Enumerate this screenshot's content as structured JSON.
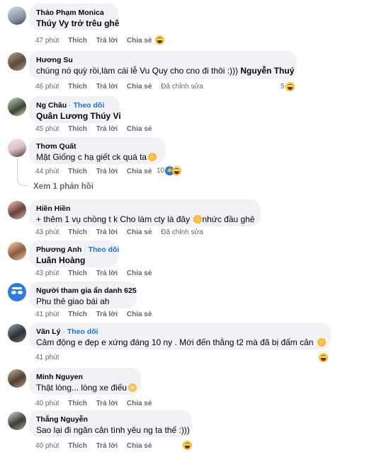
{
  "comments": [
    {
      "name": "Thảo Phạm Monica",
      "follow": "",
      "text": "Thúy Vy trở trêu ghê",
      "time": "47 phút",
      "like": "Thích",
      "reply": "Trả lời",
      "share": "Chia sẻ",
      "edited": "",
      "count": ""
    },
    {
      "name": "Hương Su",
      "follow": "",
      "text": "chúng nó quỳ rồi,làm cái lễ Vu Quy cho cno đi thôi :)))",
      "tag": "Nguyễn Thuý",
      "time": "46 phút",
      "like": "Thích",
      "reply": "Trả lời",
      "share": "Chia sẻ",
      "edited": "Đã chỉnh sửa",
      "count": "5"
    },
    {
      "name": "Ng Châu",
      "follow": "Theo dõi",
      "text": "Quân Lương Thúy Vi",
      "time": "45 phút",
      "like": "Thích",
      "reply": "Trả lời",
      "share": "Chia sẻ",
      "edited": "",
      "count": ""
    },
    {
      "name": "Thơm Quất",
      "follow": "",
      "text": "Mặt Giống c hạ giết ck quá ta",
      "time": "44 phút",
      "like": "Thích",
      "reply": "Trả lời",
      "share": "Chia sẻ",
      "edited": "",
      "count": "10"
    },
    {
      "name": "Hiền Hiền",
      "follow": "",
      "text": "+ thêm 1 vụ chồng t k Cho làm cty là đây",
      "text2": "nhức đầu ghê",
      "time": "43 phút",
      "like": "Thích",
      "reply": "Trả lời",
      "share": "Chia sẻ",
      "edited": "Đã chỉnh sửa",
      "count": ""
    },
    {
      "name": "Phương Anh",
      "follow": "Theo dõi",
      "text": "Luân Hoàng",
      "time": "43 phút",
      "like": "Thích",
      "reply": "Trả lời",
      "share": "Chia sẻ",
      "edited": "",
      "count": ""
    },
    {
      "name": "Người tham gia ẩn danh 625",
      "follow": "",
      "text": "Phu thê giao bái ah",
      "time": "41 phút",
      "like": "Thích",
      "reply": "Trả lời",
      "share": "Chia sẻ",
      "edited": "",
      "count": ""
    },
    {
      "name": "Văn Lý",
      "follow": "Theo dõi",
      "text": "Cảm động e đẹp e xứng đáng 10 ny . Mới đến thằng t2 mà đã bị đấm cản",
      "time": "41 phút",
      "like": "Thích",
      "reply": "Trả lời",
      "share": "Chia sẻ",
      "edited": "",
      "count": ""
    },
    {
      "name": "Minh Nguyen",
      "follow": "",
      "text": "Thật lòng... lòng xe điếu",
      "time": "40 phút",
      "like": "Thích",
      "reply": "Trả lời",
      "share": "Chia sẻ",
      "edited": "",
      "count": ""
    },
    {
      "name": "Thắng Nguyễn",
      "follow": "",
      "text": "Sao lại đi ngăn cản tình yêu ng ta thế :)))",
      "time": "40 phút",
      "like": "Thích",
      "reply": "Trả lời",
      "share": "Chia sẻ",
      "edited": "",
      "count": ""
    }
  ],
  "view_replies": "Xem 1 phản hồi",
  "separator": "·",
  "colors": {
    "bubble": "#f0f2f5",
    "follow": "#216fdb",
    "meta": "#65676b"
  }
}
